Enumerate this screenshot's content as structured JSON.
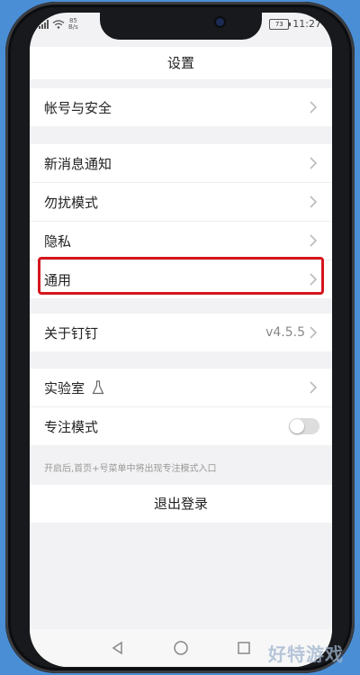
{
  "status": {
    "signal_speed": "85\nB/s",
    "battery": "73",
    "time": "11:27"
  },
  "header": {
    "title": "设置"
  },
  "sections": [
    {
      "items": [
        {
          "label": "帐号与安全"
        }
      ]
    },
    {
      "items": [
        {
          "label": "新消息通知"
        },
        {
          "label": "勿扰模式"
        },
        {
          "label": "隐私"
        },
        {
          "label": "通用"
        }
      ]
    },
    {
      "items": [
        {
          "label": "关于钉钉",
          "value": "v4.5.5"
        }
      ]
    },
    {
      "items": [
        {
          "label": "实验室"
        },
        {
          "label": "专注模式"
        }
      ]
    }
  ],
  "hint": "开启后,首页+号菜单中将出现专注模式入口",
  "logout": "退出登录",
  "watermark": "好特游戏",
  "colors": {
    "highlight": "#d5161e",
    "background": "#4a8fd6"
  }
}
